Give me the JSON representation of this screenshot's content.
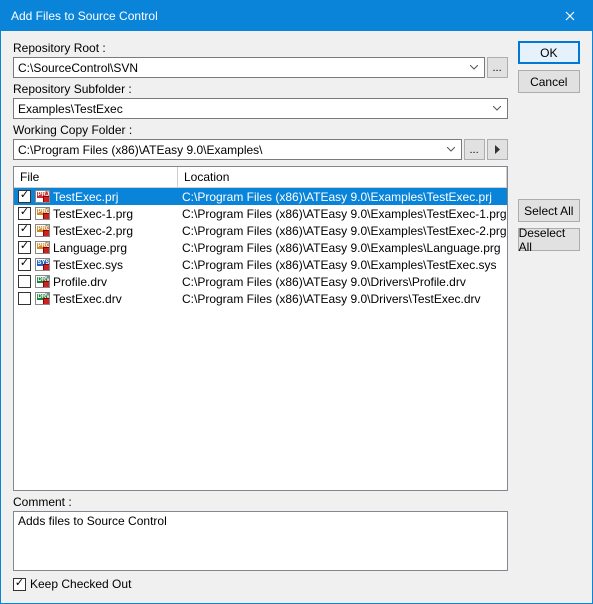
{
  "window": {
    "title": "Add Files to Source Control"
  },
  "labels": {
    "repo_root": "Repository Root :",
    "repo_sub": "Repository Subfolder :",
    "working": "Working Copy Folder :",
    "comment": "Comment :",
    "keep": "Keep Checked Out"
  },
  "fields": {
    "repo_root": "C:\\SourceControl\\SVN",
    "repo_sub": "Examples\\TestExec",
    "working": "C:\\Program Files (x86)\\ATEasy 9.0\\Examples\\",
    "comment": "Adds files to Source Control"
  },
  "columns": {
    "file": "File",
    "location": "Location"
  },
  "files": [
    {
      "checked": true,
      "selected": true,
      "ico": "prj",
      "tag": "PRJ",
      "name": "TestExec.prj",
      "loc": "C:\\Program Files (x86)\\ATEasy 9.0\\Examples\\TestExec.prj"
    },
    {
      "checked": true,
      "selected": false,
      "ico": "prg",
      "tag": "PRG",
      "name": "TestExec-1.prg",
      "loc": "C:\\Program Files (x86)\\ATEasy 9.0\\Examples\\TestExec-1.prg"
    },
    {
      "checked": true,
      "selected": false,
      "ico": "prg",
      "tag": "PRG",
      "name": "TestExec-2.prg",
      "loc": "C:\\Program Files (x86)\\ATEasy 9.0\\Examples\\TestExec-2.prg"
    },
    {
      "checked": true,
      "selected": false,
      "ico": "prg",
      "tag": "PRG",
      "name": "Language.prg",
      "loc": "C:\\Program Files (x86)\\ATEasy 9.0\\Examples\\Language.prg"
    },
    {
      "checked": true,
      "selected": false,
      "ico": "sys",
      "tag": "SYS",
      "name": "TestExec.sys",
      "loc": "C:\\Program Files (x86)\\ATEasy 9.0\\Examples\\TestExec.sys"
    },
    {
      "checked": false,
      "selected": false,
      "ico": "drv",
      "tag": "DRV",
      "name": "Profile.drv",
      "loc": "C:\\Program Files (x86)\\ATEasy 9.0\\Drivers\\Profile.drv"
    },
    {
      "checked": false,
      "selected": false,
      "ico": "drv",
      "tag": "DRV",
      "name": "TestExec.drv",
      "loc": "C:\\Program Files (x86)\\ATEasy 9.0\\Drivers\\TestExec.drv"
    }
  ],
  "buttons": {
    "ok": "OK",
    "cancel": "Cancel",
    "select_all": "Select All",
    "deselect_all": "Deselect All",
    "browse": "...",
    "go": "▶"
  },
  "keep_checked": true
}
